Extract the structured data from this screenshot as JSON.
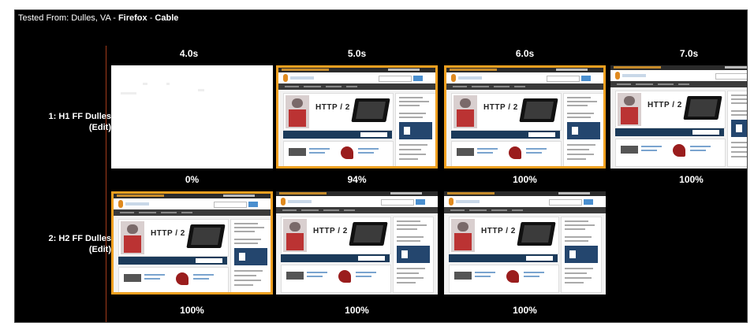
{
  "header": {
    "prefix": "Tested From: Dulles, VA - ",
    "browser": "Firefox",
    "sep": " - ",
    "connection": "Cable"
  },
  "times": [
    "4.0s",
    "5.0s",
    "6.0s",
    "7.0s"
  ],
  "rows": [
    {
      "label": "1: H1 FF Dulles",
      "edit": "(Edit)",
      "frames": [
        {
          "pct": "0%",
          "changed": false,
          "blank": true
        },
        {
          "pct": "94%",
          "changed": true,
          "blank": false
        },
        {
          "pct": "100%",
          "changed": true,
          "blank": false
        },
        {
          "pct": "100%",
          "changed": false,
          "blank": false
        }
      ]
    },
    {
      "label": "2: H2 FF Dulles",
      "edit": "(Edit)",
      "frames": [
        {
          "pct": "100%",
          "changed": true,
          "blank": false
        },
        {
          "pct": "100%",
          "changed": false,
          "blank": false
        },
        {
          "pct": "100%",
          "changed": false,
          "blank": false
        }
      ]
    }
  ],
  "thumbnail": {
    "hero_text": "HTTP / 2"
  },
  "colors": {
    "background": "#000000",
    "highlight_border": "#f0a020",
    "divider": "#a23a1a"
  }
}
